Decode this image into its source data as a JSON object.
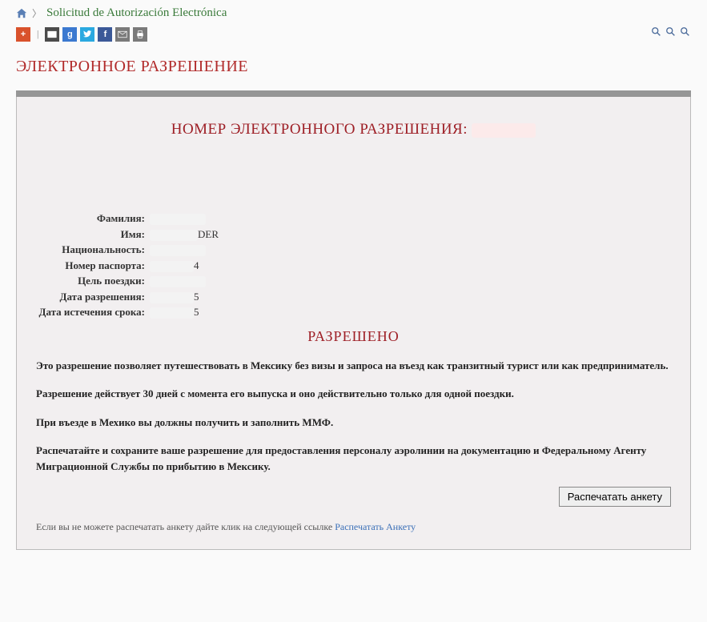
{
  "breadcrumb": {
    "title": "Solicitud de Autorización Electrónica"
  },
  "page_title": "ЭЛЕКТРОННОЕ РАЗРЕШЕНИЕ",
  "auth": {
    "label": "НОМЕР ЭЛЕКТРОННОГО РАЗРЕШЕНИЯ:"
  },
  "fields": {
    "surname_label": "Фамилия:",
    "surname_value": "",
    "name_label": "Имя:",
    "name_value_suffix": "DER",
    "nationality_label": "Национальность:",
    "nationality_value": "",
    "passport_label": "Номер паспорта:",
    "passport_value_suffix": "4",
    "purpose_label": "Цель поездки:",
    "purpose_value": "",
    "auth_date_label": "Дата разрешения:",
    "auth_date_value_suffix": "5",
    "expiry_label": "Дата истечения срока:",
    "expiry_value_suffix": "5"
  },
  "status": "РАЗРЕШЕНО",
  "paragraphs": {
    "p1": "Это разрешение позволяет путешествовать в Мексику без визы и запроса на въезд как транзитный турист или как предприниматель.",
    "p2": "Разрешение действует 30 дней с момента его выпуска и оно действительно только для одной поездки.",
    "p3": "При въезде в Мехико вы должны получить и заполнить ММФ.",
    "p4": "Распечатайте и сохраните ваше разрешение для предоставления персоналу аэролинии на документацию и Федеральному Агенту Миграционной Службы по прибытию в Мексику."
  },
  "print_button": "Распечатать анкету",
  "footer": {
    "text": "Если вы не можете распечатать анкету дайте клик на следующей ссылке ",
    "link": "Распечатать Анкету"
  }
}
